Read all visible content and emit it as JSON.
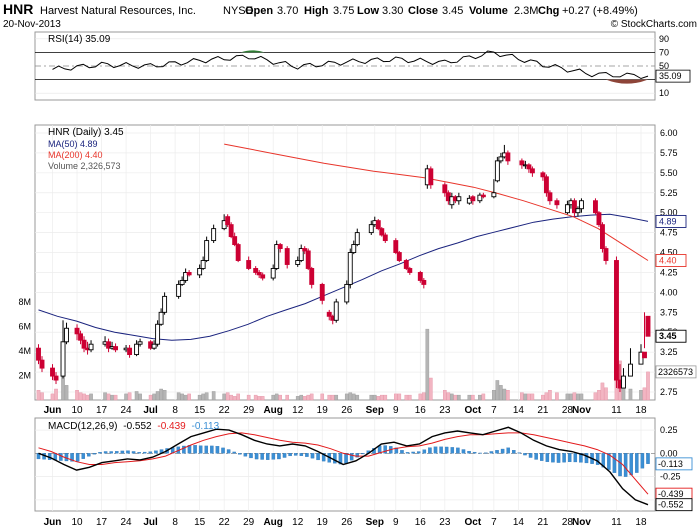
{
  "header": {
    "ticker": "HNR",
    "company": "Harvest Natural Resources, Inc.",
    "exchange": "NYSE",
    "date": "20-Nov-2013",
    "open_label": "Open",
    "open": "3.70",
    "high_label": "High",
    "high": "3.75",
    "low_label": "Low",
    "low": "3.30",
    "close_label": "Close",
    "close": "3.45",
    "volume_label": "Volume",
    "volume": "2.3M",
    "chg_label": "Chg",
    "chg": "+0.27 (+8.49%)",
    "watermark": "© StockCharts.com"
  },
  "colors": {
    "up": "#000000",
    "down": "#cc0033",
    "ma50": "#1a237e",
    "ma200": "#e8352b",
    "rsi": "#000000",
    "rsi_over": "#2e7d32",
    "rsi_under": "#8d4438",
    "vol_up": "#b5b5b5",
    "vol_down": "#f2b5c2",
    "macd": "#000000",
    "signal": "#e31a1c",
    "hist": "#3b8fd4"
  },
  "chart_data": [
    {
      "type": "line",
      "panel": "rsi",
      "legend": "RSI(14) 35.09",
      "ylim": [
        0,
        100
      ],
      "ticks": [
        "90",
        "70",
        "50",
        "30",
        "10"
      ],
      "tick_values": [
        90,
        70,
        50,
        30,
        10
      ],
      "last_label": "35.09",
      "x": [
        "2013-06-03",
        "2013-06-17",
        "2013-07-01",
        "2013-07-15",
        "2013-07-29",
        "2013-08-12",
        "2013-08-26",
        "2013-09-09",
        "2013-09-23",
        "2013-10-07",
        "2013-10-21",
        "2013-11-04",
        "2013-11-20"
      ],
      "values": [
        45,
        52,
        50,
        58,
        64,
        49,
        56,
        60,
        55,
        70,
        52,
        38,
        35.09
      ]
    },
    {
      "type": "candlestick",
      "panel": "price",
      "legend": {
        "symbol": "HNR (Daily) 3.45",
        "ma50": "MA(50) 4.89",
        "ma200": "MA(200) 4.40",
        "volume": "Volume 2,326,573"
      },
      "ylim": [
        2.65,
        6.1
      ],
      "y_ticks": [
        "6.00",
        "5.75",
        "5.50",
        "5.25",
        "5.00",
        "4.75",
        "4.50",
        "4.25",
        "4.00",
        "3.75",
        "3.50",
        "3.25",
        "3.00",
        "2.75"
      ],
      "y_tick_values": [
        6.0,
        5.75,
        5.5,
        5.25,
        5.0,
        4.75,
        4.5,
        4.25,
        4.0,
        3.75,
        3.5,
        3.25,
        3.0,
        2.75
      ],
      "last_labels": {
        "ma50": "4.89",
        "ma200": "4.40",
        "close": "3.45",
        "volume": "2326573"
      },
      "volume_ticks": [
        "8M",
        "6M",
        "4M",
        "2M"
      ],
      "volume_tick_values": [
        8,
        6,
        4,
        2
      ],
      "volume_unit": "M",
      "x_ticks": [
        "Jun",
        "10",
        "17",
        "24",
        "Jul",
        "8",
        "15",
        "22",
        "29",
        "Aug",
        "12",
        "19",
        "26",
        "Sep",
        "9",
        "16",
        "23",
        "Oct",
        "7",
        "14",
        "21",
        "28",
        "Nov",
        "11",
        "18"
      ],
      "x_tick_dates": [
        "2013-06-03",
        "2013-06-10",
        "2013-06-17",
        "2013-06-24",
        "2013-07-01",
        "2013-07-08",
        "2013-07-15",
        "2013-07-22",
        "2013-07-29",
        "2013-08-05",
        "2013-08-12",
        "2013-08-19",
        "2013-08-26",
        "2013-09-03",
        "2013-09-09",
        "2013-09-16",
        "2013-09-23",
        "2013-10-01",
        "2013-10-07",
        "2013-10-14",
        "2013-10-21",
        "2013-10-28",
        "2013-11-01",
        "2013-11-11",
        "2013-11-18"
      ],
      "x_tick_bold": [
        "Jun",
        "Jul",
        "Aug",
        "Sep",
        "Oct",
        "Nov"
      ],
      "close": [
        3.15,
        3.05,
        2.95,
        2.9,
        3.38,
        3.55,
        3.48,
        3.4,
        3.3,
        3.28,
        3.35,
        3.38,
        3.3,
        3.32,
        3.28,
        3.3,
        3.22,
        3.35,
        3.38,
        3.3,
        3.35,
        3.6,
        3.75,
        3.95,
        4.1,
        4.15,
        4.25,
        4.22,
        4.3,
        4.4,
        4.65,
        4.8,
        4.9,
        4.85,
        4.7,
        4.6,
        4.4,
        4.3,
        4.25,
        4.22,
        4.18,
        4.3,
        4.6,
        4.55,
        4.35,
        4.4,
        4.55,
        4.52,
        4.3,
        4.1,
        3.9,
        3.7,
        3.65,
        3.88,
        4.1,
        4.5,
        4.6,
        4.75,
        4.85,
        4.9,
        4.8,
        4.72,
        4.65,
        4.5,
        4.4,
        4.3,
        4.25,
        4.15,
        4.1,
        5.55,
        5.35,
        5.25,
        5.15,
        5.2,
        5.15,
        5.2,
        5.18,
        5.15,
        5.22,
        5.2,
        5.25,
        5.65,
        5.7,
        5.75,
        5.65,
        5.6,
        5.6,
        5.55,
        5.5,
        5.45,
        5.25,
        5.15,
        5.1,
        5.1,
        5.15,
        5.0,
        5.05,
        5.15,
        5.0,
        4.85,
        4.55,
        4.4,
        2.9,
        2.8,
        2.95,
        3.1,
        3.25,
        3.18,
        3.45
      ],
      "open": [
        3.3,
        3.15,
        3.05,
        2.95,
        2.95,
        3.38,
        3.55,
        3.48,
        3.4,
        3.3,
        3.28,
        3.35,
        3.38,
        3.3,
        3.32,
        3.28,
        3.3,
        3.22,
        3.35,
        3.38,
        3.3,
        3.35,
        3.6,
        3.75,
        3.95,
        4.1,
        4.15,
        4.25,
        4.22,
        4.3,
        4.4,
        4.65,
        4.8,
        4.95,
        4.85,
        4.7,
        4.6,
        4.4,
        4.3,
        4.25,
        4.22,
        4.18,
        4.3,
        4.6,
        4.55,
        4.35,
        4.4,
        4.55,
        4.52,
        4.3,
        4.1,
        3.75,
        3.7,
        3.65,
        3.88,
        4.1,
        4.5,
        4.6,
        4.75,
        4.85,
        4.9,
        4.8,
        4.72,
        4.65,
        4.5,
        4.4,
        4.3,
        4.25,
        4.15,
        5.35,
        5.55,
        5.35,
        5.25,
        5.1,
        5.2,
        5.15,
        5.12,
        5.2,
        5.15,
        5.22,
        5.2,
        5.4,
        5.65,
        5.7,
        5.75,
        5.65,
        5.6,
        5.6,
        5.55,
        5.5,
        5.45,
        5.25,
        5.15,
        5.0,
        5.1,
        5.15,
        5.0,
        5.05,
        5.15,
        5.0,
        4.85,
        4.55,
        4.4,
        2.9,
        2.8,
        2.95,
        3.1,
        3.25,
        3.7
      ],
      "high": [
        3.35,
        3.2,
        3.1,
        3.0,
        3.65,
        3.62,
        3.6,
        3.52,
        3.45,
        3.38,
        3.4,
        3.45,
        3.42,
        3.38,
        3.36,
        3.34,
        3.34,
        3.4,
        3.42,
        3.4,
        3.4,
        3.65,
        3.8,
        4.0,
        4.15,
        4.2,
        4.3,
        4.28,
        4.35,
        4.45,
        4.7,
        4.85,
        4.98,
        4.98,
        4.88,
        4.75,
        4.62,
        4.45,
        4.33,
        4.28,
        4.25,
        4.35,
        4.65,
        4.62,
        4.58,
        4.45,
        4.6,
        4.58,
        4.55,
        4.32,
        4.12,
        3.78,
        3.72,
        3.92,
        4.15,
        4.55,
        4.65,
        4.8,
        4.9,
        4.95,
        4.92,
        4.82,
        4.75,
        4.68,
        4.52,
        4.42,
        4.32,
        4.27,
        4.18,
        5.6,
        5.58,
        5.38,
        5.28,
        5.25,
        5.22,
        5.25,
        5.22,
        5.22,
        5.25,
        5.25,
        5.42,
        5.7,
        5.75,
        5.85,
        5.78,
        5.68,
        5.65,
        5.62,
        5.58,
        5.52,
        5.48,
        5.28,
        5.18,
        5.15,
        5.18,
        5.18,
        5.08,
        5.18,
        5.18,
        5.02,
        4.88,
        4.58,
        4.45,
        3.1,
        3.05,
        3.3,
        3.35,
        3.75
      ],
      "low": [
        3.1,
        3.0,
        2.9,
        2.85,
        2.92,
        3.35,
        3.4,
        3.35,
        3.25,
        3.22,
        3.25,
        3.32,
        3.25,
        3.28,
        3.25,
        3.25,
        3.18,
        3.2,
        3.32,
        3.28,
        3.28,
        3.32,
        3.58,
        3.72,
        3.92,
        4.08,
        4.12,
        4.2,
        4.18,
        4.28,
        4.38,
        4.62,
        4.78,
        4.82,
        4.68,
        4.58,
        4.38,
        4.28,
        4.22,
        4.18,
        4.15,
        4.15,
        4.28,
        4.5,
        4.3,
        4.32,
        4.38,
        4.48,
        4.28,
        4.05,
        3.85,
        3.65,
        3.6,
        3.62,
        3.85,
        4.05,
        4.48,
        4.58,
        4.72,
        4.82,
        4.78,
        4.7,
        4.62,
        4.48,
        4.38,
        4.28,
        4.22,
        4.12,
        4.05,
        5.3,
        5.3,
        5.2,
        5.1,
        5.05,
        5.12,
        5.1,
        5.1,
        5.1,
        5.12,
        5.18,
        5.18,
        5.38,
        5.62,
        5.68,
        5.6,
        5.55,
        5.55,
        5.5,
        5.45,
        5.4,
        5.2,
        5.1,
        5.05,
        4.98,
        5.05,
        4.95,
        4.95,
        5.0,
        4.98,
        4.82,
        4.5,
        4.35,
        2.8,
        2.75,
        2.85,
        3.0,
        3.15,
        3.3
      ],
      "volume": [
        0.8,
        0.6,
        0.5,
        0.9,
        2.4,
        1.2,
        0.8,
        0.6,
        0.5,
        0.4,
        0.5,
        0.6,
        0.5,
        0.4,
        0.4,
        0.5,
        0.6,
        0.7,
        0.5,
        0.4,
        0.5,
        0.7,
        0.9,
        0.8,
        0.6,
        0.5,
        0.4,
        0.5,
        0.4,
        0.5,
        0.6,
        0.7,
        0.5,
        0.6,
        0.4,
        0.3,
        0.5,
        0.4,
        0.4,
        0.3,
        0.3,
        0.4,
        0.5,
        0.4,
        0.4,
        0.3,
        0.4,
        0.3,
        0.4,
        0.5,
        0.5,
        0.4,
        0.4,
        0.4,
        0.5,
        0.6,
        0.5,
        0.4,
        0.4,
        0.4,
        0.3,
        0.4,
        0.4,
        0.5,
        0.5,
        0.4,
        0.4,
        0.5,
        0.6,
        5.8,
        1.8,
        0.8,
        0.6,
        0.5,
        0.4,
        0.4,
        0.4,
        0.4,
        0.4,
        0.5,
        0.8,
        1.6,
        1.2,
        0.9,
        0.8,
        0.6,
        0.5,
        0.5,
        0.5,
        0.4,
        0.6,
        0.8,
        0.6,
        0.5,
        0.5,
        0.6,
        0.5,
        0.5,
        0.6,
        0.8,
        1.4,
        1.0,
        7.0,
        3.2,
        1.2,
        0.9,
        0.8,
        1.0,
        2.3
      ],
      "ma50": [
        3.78,
        3.7,
        3.64,
        3.56,
        3.5,
        3.46,
        3.42,
        3.4,
        3.41,
        3.45,
        3.52,
        3.6,
        3.7,
        3.78,
        3.86,
        3.96,
        4.06,
        4.16,
        4.27,
        4.36,
        4.46,
        4.55,
        4.62,
        4.7,
        4.76,
        4.82,
        4.88,
        4.92,
        4.95,
        4.97,
        4.98,
        4.94,
        4.89
      ],
      "ma200": [
        5.86,
        5.8,
        5.74,
        5.68,
        5.62,
        5.57,
        5.52,
        5.48,
        5.44,
        5.38,
        5.32,
        5.24,
        5.15,
        5.05,
        4.95,
        4.8,
        4.6,
        4.4
      ]
    },
    {
      "type": "line",
      "panel": "macd",
      "legend": {
        "name": "MACD(12,26,9)",
        "macd": "-0.552",
        "signal": "-0.439",
        "hist": "-0.113"
      },
      "ylim": [
        -0.62,
        0.38
      ],
      "ticks": [
        "0.25",
        "0.00",
        "-0.25",
        "-0.50"
      ],
      "tick_values": [
        0.25,
        0.0,
        -0.25,
        -0.5
      ],
      "last_labels": {
        "hist": "-0.113",
        "signal": "-0.439",
        "macd": "-0.552"
      },
      "macd": [
        0.0,
        -0.05,
        -0.12,
        -0.18,
        -0.15,
        -0.1,
        -0.08,
        -0.06,
        -0.07,
        -0.04,
        0.02,
        0.1,
        0.18,
        0.22,
        0.26,
        0.25,
        0.2,
        0.14,
        0.1,
        0.08,
        0.1,
        0.08,
        0.02,
        -0.05,
        -0.12,
        -0.08,
        0.0,
        0.1,
        0.12,
        0.08,
        0.1,
        0.18,
        0.22,
        0.24,
        0.22,
        0.2,
        0.24,
        0.28,
        0.22,
        0.14,
        0.08,
        0.04,
        0.02,
        -0.02,
        -0.08,
        -0.2,
        -0.38,
        -0.5,
        -0.552
      ],
      "signal": [
        0.06,
        0.02,
        -0.04,
        -0.09,
        -0.12,
        -0.12,
        -0.1,
        -0.09,
        -0.08,
        -0.06,
        -0.03,
        0.03,
        0.09,
        0.14,
        0.18,
        0.21,
        0.22,
        0.2,
        0.17,
        0.14,
        0.12,
        0.11,
        0.09,
        0.05,
        0.0,
        -0.03,
        -0.03,
        0.01,
        0.05,
        0.07,
        0.08,
        0.11,
        0.15,
        0.18,
        0.2,
        0.2,
        0.21,
        0.22,
        0.22,
        0.2,
        0.17,
        0.14,
        0.11,
        0.08,
        0.04,
        -0.02,
        -0.12,
        -0.28,
        -0.439
      ],
      "hist": [
        -0.06,
        -0.07,
        -0.08,
        -0.09,
        -0.03,
        0.02,
        0.02,
        0.03,
        0.01,
        0.02,
        0.05,
        0.07,
        0.09,
        0.08,
        0.08,
        0.04,
        -0.02,
        -0.06,
        -0.07,
        -0.06,
        -0.02,
        -0.03,
        -0.07,
        -0.1,
        -0.12,
        -0.05,
        0.03,
        0.09,
        0.07,
        0.01,
        0.02,
        0.07,
        0.07,
        0.06,
        0.02,
        0.0,
        0.03,
        0.06,
        0.0,
        -0.06,
        -0.09,
        -0.1,
        -0.09,
        -0.1,
        -0.12,
        -0.18,
        -0.26,
        -0.22,
        -0.113
      ]
    }
  ]
}
